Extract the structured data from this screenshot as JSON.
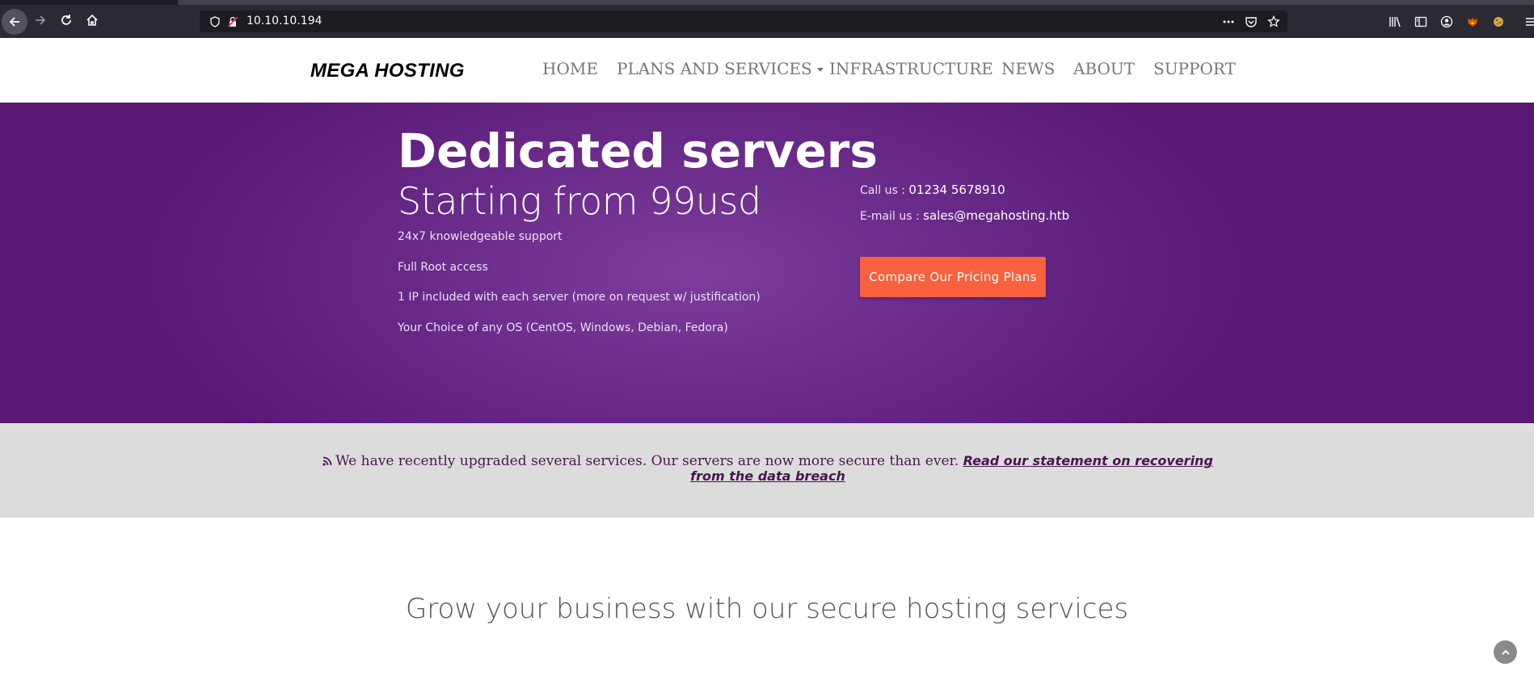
{
  "browser": {
    "url": "10.10.10.194"
  },
  "header": {
    "logo": "MEGA HOSTING",
    "nav": [
      {
        "label": "HOME"
      },
      {
        "label": "PLANS AND SERVICES"
      },
      {
        "label": "INFRASTRUCTURE"
      },
      {
        "label": "NEWS"
      },
      {
        "label": "ABOUT"
      },
      {
        "label": "SUPPORT"
      }
    ]
  },
  "hero": {
    "title": "Dedicated servers",
    "subtitle": "Starting from 99usd",
    "features": [
      "24x7 knowledgeable support",
      "Full Root access",
      "1 IP included with each server (more on request w/ justification)",
      "Your Choice of any OS (CentOS, Windows, Debian, Fedora)"
    ],
    "call_label": "Call us : ",
    "call_value": "01234 5678910",
    "email_label": "E-mail us : ",
    "email_value": "sales@megahosting.htb",
    "cta_label": "Compare Our Pricing Plans",
    "cta_color": "#f8603e",
    "bg_color": "#6a2b8a"
  },
  "notice": {
    "text": "We have recently upgraded several services. Our servers are now more secure than ever.",
    "link": "Read our statement on recovering from the data breach",
    "icon": "rss-icon"
  },
  "main": {
    "heading": "Grow your business with our secure hosting services"
  }
}
